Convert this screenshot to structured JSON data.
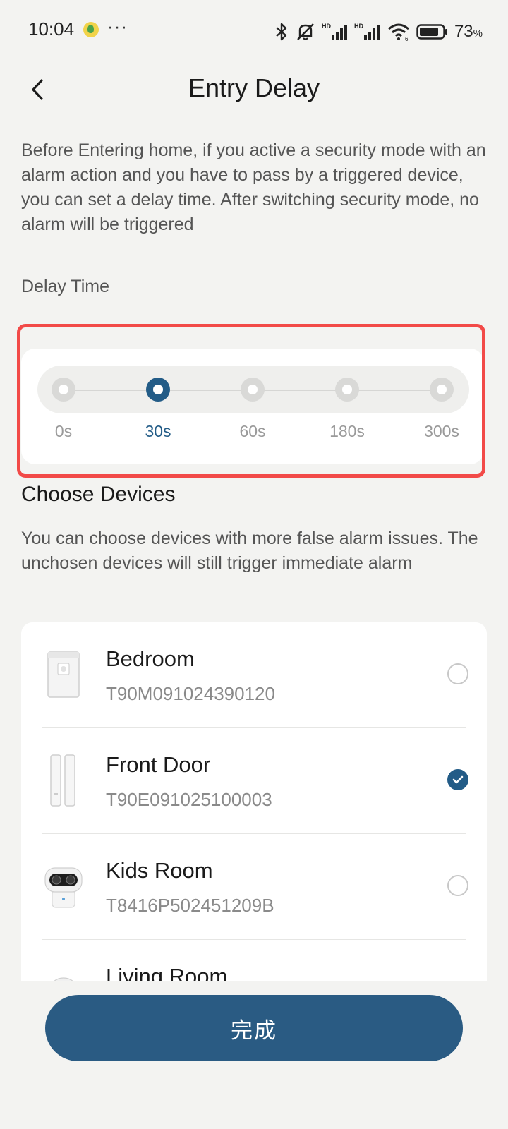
{
  "status_bar": {
    "time": "10:04",
    "more": "···",
    "battery_percent": "73",
    "battery_unit": "%",
    "icons": [
      "app-notification-icon",
      "bluetooth-icon",
      "mute-icon",
      "hd-signal-icon",
      "hd-signal-icon",
      "wifi-icon",
      "battery-icon"
    ]
  },
  "header": {
    "title": "Entry Delay",
    "back_icon": "chevron-left-icon"
  },
  "description": "Before Entering home, if you active a security mode with an alarm action and you have to pass by a triggered device, you can set a delay time. After switching security mode, no alarm will be triggered",
  "delay_time": {
    "label": "Delay Time",
    "options": [
      "0s",
      "30s",
      "60s",
      "180s",
      "300s"
    ],
    "selected": "30s"
  },
  "choose_devices": {
    "title": "Choose Devices",
    "description": "You can choose devices with more false alarm issues. The unchosen devices will still trigger immediate alarm",
    "devices": [
      {
        "name": "Bedroom",
        "serial": "T90M091024390120",
        "selected": false,
        "icon": "motion-sensor-icon"
      },
      {
        "name": "Front Door",
        "serial": "T90E091025100003",
        "selected": true,
        "icon": "door-sensor-icon"
      },
      {
        "name": "Kids Room",
        "serial": "T8416P502451209B",
        "selected": false,
        "icon": "indoor-camera-icon"
      },
      {
        "name": "Living Room",
        "serial": "",
        "selected": false,
        "icon": "camera-icon"
      }
    ]
  },
  "done_button": {
    "label": "完成"
  },
  "colors": {
    "accent": "#235c87",
    "button": "#2a5b83",
    "highlight": "#f24a48",
    "background": "#f3f3f1"
  }
}
